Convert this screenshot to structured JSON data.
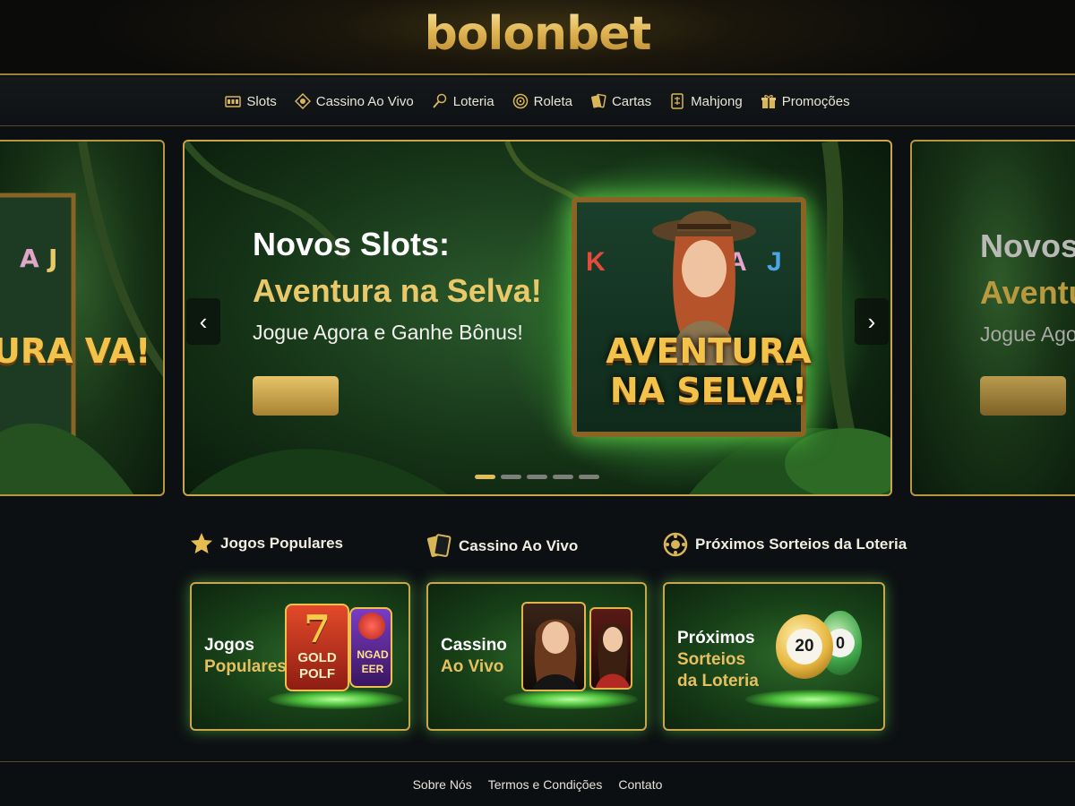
{
  "brand": {
    "logo_text": "bolonbet",
    "accent": "#e0b553",
    "glow": "#5fd94a"
  },
  "nav": {
    "items": [
      {
        "label": "Slots",
        "icon": "slot-machine-icon"
      },
      {
        "label": "Cassino Ao Vivo",
        "icon": "chip-icon"
      },
      {
        "label": "Loteria",
        "icon": "lottery-icon"
      },
      {
        "label": "Roleta",
        "icon": "roulette-icon"
      },
      {
        "label": "Cartas",
        "icon": "cards-icon"
      },
      {
        "label": "Mahjong",
        "icon": "mahjong-icon"
      },
      {
        "label": "Promoções",
        "icon": "gift-icon"
      }
    ]
  },
  "carousel": {
    "title_line1": "Novos Slots:",
    "title_line2": "Aventura na Selva!",
    "subtitle": "Jogue Agora e Ganhe Bônus!",
    "art_title": "AVENTURA NA SELVA!",
    "side_right": {
      "line1": "Novos S",
      "line2": "Aventu",
      "line3": "Jogue Ago"
    },
    "side_left": {
      "art_text": "URA VA!"
    },
    "slide_count": 5,
    "active_slide": 1,
    "reel_symbols": [
      "K",
      "A",
      "J",
      "A",
      "J"
    ]
  },
  "sections": [
    {
      "heading": "Jogos Populares",
      "icon": "star-icon",
      "card_line1": "Jogos",
      "card_line2": "Populares",
      "art": [
        "GOLD",
        "POLF",
        "NGAD",
        "EER"
      ]
    },
    {
      "heading": "Cassino Ao Vivo",
      "icon": "cards-icon",
      "card_line1": "Cassino",
      "card_line2": "Ao Vivo"
    },
    {
      "heading": "Próximos Sorteios da Loteria",
      "icon": "lottery-ball-icon",
      "card_line1": "Próximos",
      "card_line2": "Sorteios",
      "card_line3": "da Loteria",
      "balls": [
        "20",
        "0"
      ]
    }
  ],
  "footer": {
    "links": [
      "Sobre Nós",
      "Termos e Condições",
      "Contato"
    ]
  }
}
